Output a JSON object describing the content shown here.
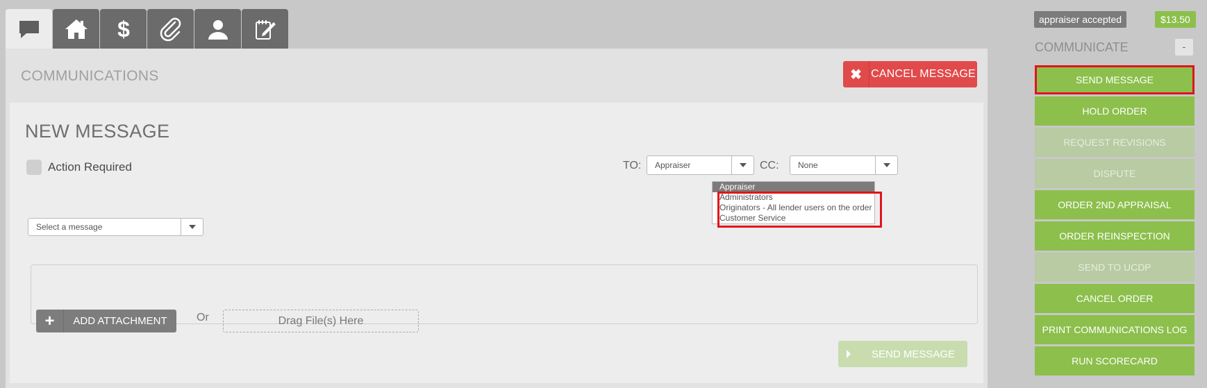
{
  "tabs": [
    {
      "icon": "chat-icon"
    },
    {
      "icon": "home-icon"
    },
    {
      "icon": "dollar-icon"
    },
    {
      "icon": "paperclip-icon"
    },
    {
      "icon": "user-icon"
    },
    {
      "icon": "notepad-icon"
    }
  ],
  "panel": {
    "title": "COMMUNICATIONS",
    "cancel_label": "CANCEL MESSAGE"
  },
  "form": {
    "title": "NEW MESSAGE",
    "action_required_label": "Action Required",
    "to_label": "TO:",
    "to_value": "Appraiser",
    "cc_label": "CC:",
    "cc_value": "None",
    "message_select": "Select a message",
    "to_options": [
      "Appraiser",
      "Administrators",
      "Originators - All lender users on the order",
      "Customer Service"
    ],
    "add_attachment_label": "ADD ATTACHMENT",
    "or_label": "Or",
    "drop_zone_label": "Drag File(s) Here",
    "send_label": "SEND MESSAGE"
  },
  "sidebar": {
    "status": "appraiser accepted",
    "price": "$13.50",
    "section_title": "COMMUNICATE",
    "collapse_label": "-",
    "actions": [
      {
        "label": "SEND MESSAGE",
        "enabled": true,
        "highlighted": true
      },
      {
        "label": "HOLD ORDER",
        "enabled": true
      },
      {
        "label": "REQUEST REVISIONS",
        "enabled": false
      },
      {
        "label": "DISPUTE",
        "enabled": false
      },
      {
        "label": "ORDER 2ND APPRAISAL",
        "enabled": true
      },
      {
        "label": "ORDER REINSPECTION",
        "enabled": true
      },
      {
        "label": "SEND TO UCDP",
        "enabled": false
      },
      {
        "label": "CANCEL ORDER",
        "enabled": true
      },
      {
        "label": "PRINT COMMUNICATIONS LOG",
        "enabled": true
      },
      {
        "label": "RUN SCORECARD",
        "enabled": true
      }
    ]
  },
  "colors": {
    "green": "#8cbf4c",
    "red": "#e14a4a",
    "highlight": "#e0151c"
  }
}
